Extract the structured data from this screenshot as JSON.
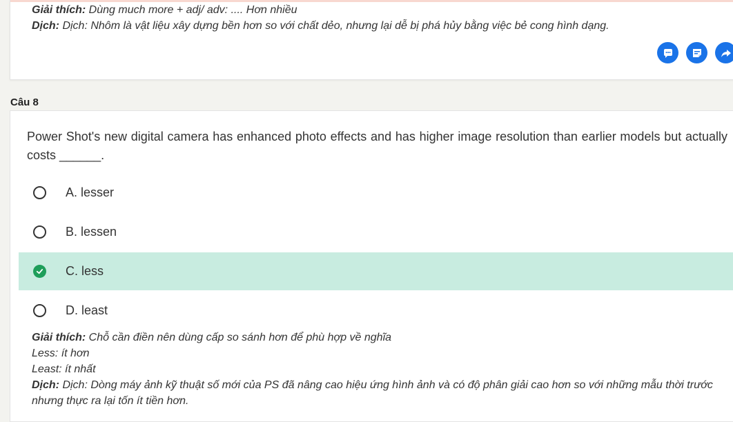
{
  "previous": {
    "explanation_label": "Giải thích:",
    "explanation_text": " Dùng much more + adj/ adv: .... Hơn nhiều",
    "translation_label": "Dịch:",
    "translation_text": " Dịch: Nhôm là vật liệu xây dựng bền hơn so với chất dẻo, nhưng lại dễ bị phá hủy bằng việc bẻ cong hình dạng."
  },
  "actions": [
    {
      "name": "comment-icon"
    },
    {
      "name": "note-icon"
    },
    {
      "name": "share-icon"
    }
  ],
  "question": {
    "label": "Câu 8",
    "text": "Power Shot's new digital camera has enhanced photo effects and has higher image resolution than earlier models but actually costs ______.",
    "options": [
      {
        "label": "A. lesser",
        "selected": false
      },
      {
        "label": "B. lessen",
        "selected": false
      },
      {
        "label": "C. less",
        "selected": true
      },
      {
        "label": "D. least",
        "selected": false
      }
    ],
    "explanation_label": "Giải thích:",
    "explanation_text": " Chỗ cần điền nên dùng cấp so sánh hơn để phù hợp về nghĩa",
    "note1": "Less: ít hơn",
    "note2": "Least: ít nhất",
    "translation_label": "Dịch:",
    "translation_text": " Dịch: Dòng máy ảnh kỹ thuật số mới của PS đã nâng cao hiệu ứng hình ảnh và có độ phân giải cao hơn so với những mẫu thời trước nhưng thực ra lại tốn ít tiền hơn."
  },
  "colors": {
    "accent_blue": "#1a73e8",
    "selected_bg": "#c8ece0",
    "check_green": "#1e9e5a"
  }
}
